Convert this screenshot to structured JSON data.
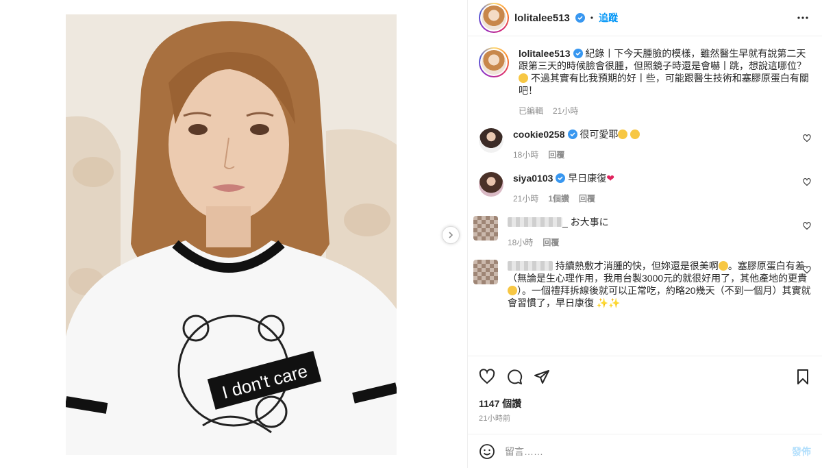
{
  "post": {
    "username": "lolitalee513",
    "follow_label": "追蹤",
    "dot": "•",
    "caption_text": "紀錄丨下今天腫臉的模樣，雖然醫生早就有說第二天跟第三天的時候臉會很腫，但照鏡子時還是會嚇丨跳，想說這哪位？",
    "caption_text2": "不過其實有比我預期的好丨些，可能跟醫生技術和塞膠原蛋白有關吧！",
    "caption_meta_edited": "已編輯",
    "caption_meta_time": "21小時"
  },
  "image": {
    "shirt_text": "I don't care"
  },
  "comments": [
    {
      "user": "cookie0258",
      "text": "很可愛耶",
      "time": "18小時",
      "reply": "回覆",
      "verified": true
    },
    {
      "user": "siya0103",
      "text": "早日康復",
      "time": "21小時",
      "likes": "1個讚",
      "reply": "回覆",
      "verified": true
    },
    {
      "user_suffix": "_",
      "text": "お大事に",
      "time": "18小時",
      "reply": "回覆"
    },
    {
      "text": "持續熱敷才消腫的快，但妳還是很美啊",
      "text2": "。塞膠原蛋白有差（無論是生心理作用，我用台製3000元的就很好用了，其他產地的更貴",
      "text3": "）。一個禮拜拆線後就可以正常吃，約略20幾天（不到一個月）其實就會習慣了，早日康復"
    }
  ],
  "actions": {
    "likes": "1147 個讚",
    "posted": "21小時前"
  },
  "composer": {
    "placeholder": "留言……",
    "post_label": "發佈"
  },
  "colors": {
    "accent": "#0095f6",
    "verified": "#3897f0",
    "post_disabled": "#b2dffc"
  }
}
